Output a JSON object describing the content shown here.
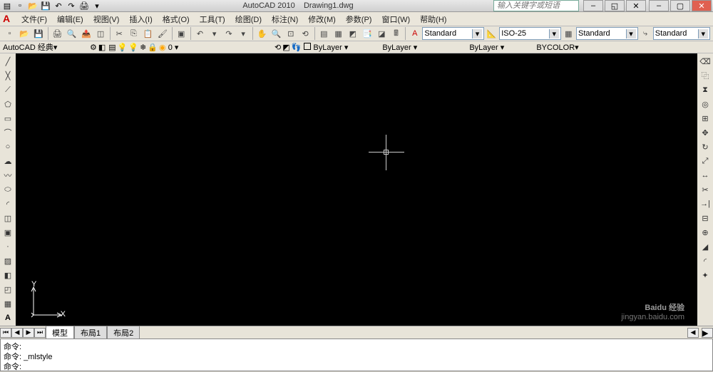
{
  "title": {
    "app": "AutoCAD 2010",
    "doc": "Drawing1.dwg"
  },
  "search_placeholder": "输入关键字或短语",
  "menu": [
    "文件(F)",
    "编辑(E)",
    "视图(V)",
    "插入(I)",
    "格式(O)",
    "工具(T)",
    "绘图(D)",
    "标注(N)",
    "修改(M)",
    "参数(P)",
    "窗口(W)",
    "帮助(H)"
  ],
  "workspace": "AutoCAD 经典",
  "layer_value": "0",
  "style_combos": {
    "text_style": "Standard",
    "dim_style": "ISO-25",
    "table_style": "Standard",
    "mleader_style": "Standard"
  },
  "layer_combos": {
    "layer": "ByLayer",
    "linetype": "ByLayer",
    "lineweight": "ByLayer",
    "color": "BYCOLOR"
  },
  "tabs": {
    "model": "模型",
    "layout1": "布局1",
    "layout2": "布局2"
  },
  "cmd": {
    "line1": "命令:",
    "line2": "命令: _mlstyle",
    "line3": "命令:"
  },
  "ucs": {
    "x": "X",
    "y": "Y"
  },
  "watermark": {
    "brand": "Baidu 经验",
    "url": "jingyan.baidu.com"
  }
}
